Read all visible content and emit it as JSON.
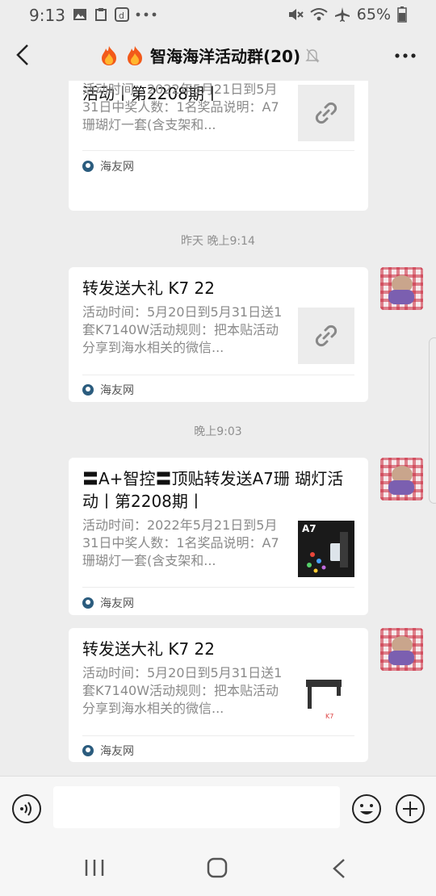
{
  "status_bar": {
    "time": "9:13",
    "battery": "65%"
  },
  "header": {
    "title": "智海海洋活动群(20)"
  },
  "messages": [
    {
      "title": "活动丨第2208期丨",
      "desc": "活动时间：2022年5月21日到5月31日中奖人数：1名奖品说明：A7珊瑚灯一套(含支架和...",
      "source": "海友网"
    },
    {
      "title": "转发送大礼 K7 22",
      "desc": "活动时间：5月20日到5月31日送1套K7140W活动规则：把本贴活动分享到海水相关的微信...",
      "source": "海友网"
    },
    {
      "title": "〓A+智控〓顶贴转发送A7珊 瑚灯活动丨第2208期丨",
      "desc": "活动时间：2022年5月21日到5月31日中奖人数：1名奖品说明：A7珊瑚灯一套(含支架和...",
      "source": "海友网",
      "thumb_label": "A7"
    },
    {
      "title": "转发送大礼 K7 22",
      "desc": "活动时间：5月20日到5月31日送1套K7140W活动规则：把本贴活动分享到海水相关的微信...",
      "source": "海友网"
    }
  ],
  "timestamps": [
    "昨天 晚上9:14",
    "晚上9:03"
  ],
  "colors": {
    "background": "#ededed",
    "card": "#ffffff",
    "muted_text": "#8a8a8a"
  }
}
